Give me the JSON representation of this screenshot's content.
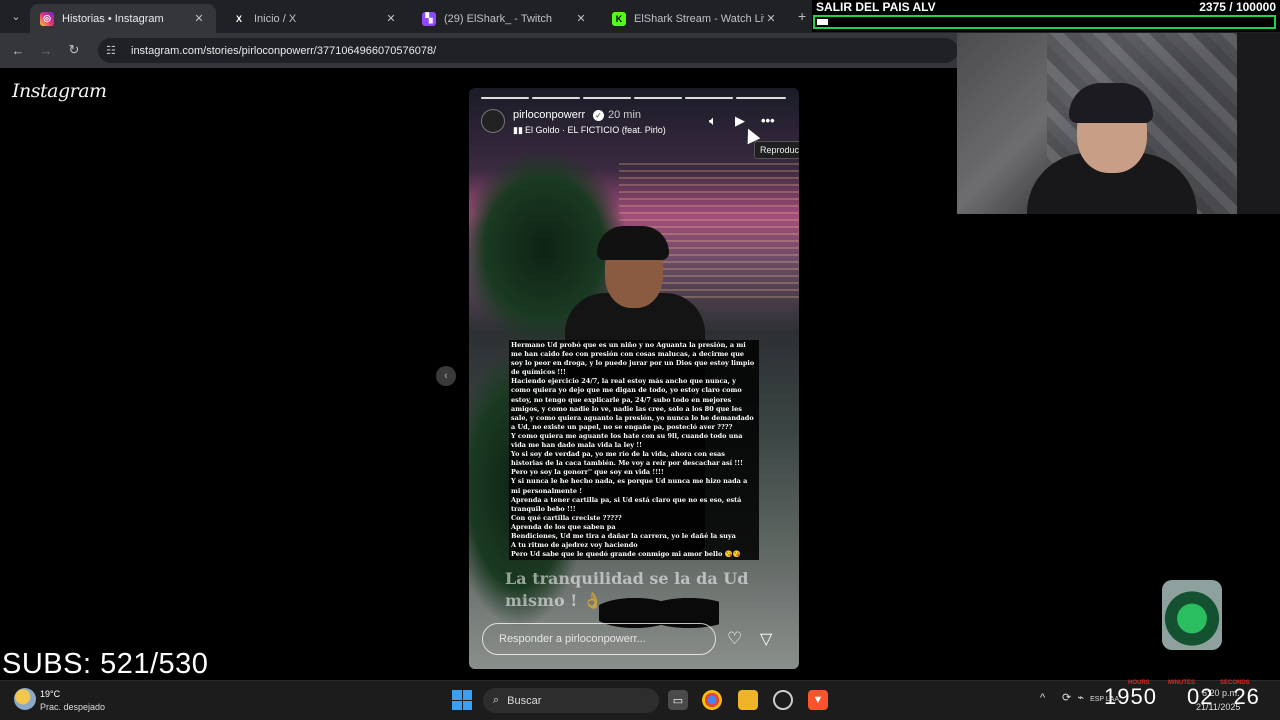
{
  "browser": {
    "tabs": [
      {
        "title": "Historias • Instagram",
        "active": true,
        "favicon": "instagram-icon"
      },
      {
        "title": "Inicio / X",
        "active": false,
        "favicon": "x-icon"
      },
      {
        "title": "(29) ElShark_ - Twitch",
        "active": false,
        "favicon": "twitch-icon"
      },
      {
        "title": "ElShark Stream - Watch Live on",
        "active": false,
        "favicon": "kick-icon"
      }
    ],
    "url": "instagram.com/stories/pirloconpowerr/3771064966070576078/"
  },
  "instagram": {
    "logo": "Instagram",
    "story": {
      "username": "pirloconpowerr",
      "time": "20 min",
      "music": "El Goldo · EL FICTICIO (feat. Pirlo)",
      "tooltip": "Reproducir",
      "text_lines": [
        "Hermano Ud probó que es un niño y no Aguanta la presión, a mi me han caido feo con presión con cosas malucas, a decirme que soy lo peor en droga, y lo puedo jurar por un Dios que estoy limpio de químicos !!!",
        "Haciendo ejercicio 24/7, la real estoy más ancho que nunca, y como quiera yo dejo que me digan de todo, yo estoy claro como estoy, no tengo que explicarle pa, 24/7 subo todo en mejores amigos, y como nadie lo ve, nadie las cree, solo a los 80 que les sale, y como quiera aguanto la presión, yo nunca lo he demandado a Ud, no existe un papel, no se engañe pa, postecló aver ????",
        "Y como quiera me aguante los hate con su 9ll, cuando todo una vida me han dado mala vida la ley !!",
        "Yo si soy de verdad pa, yo me río de la vida, ahora con esas historias de la caca también. Me voy a reír por descachar así !!!",
        "Pero yo soy la gonorr'' que soy en vida !!!!",
        "Y si nunca le he hecho nada, es porque Ud nunca me hizo nada a mi personalmente !",
        "Aprenda a tener cartilla pa, si Ud está claro que no es eso, está tranquilo bebo !!!",
        "Con qué cartilla creciste ?????",
        "Aprenda de los que saben pa",
        "Bendiciones, Ud me tira a dañar la carrera, yo le dañé la suya",
        "A tu ritmo de ajedrez voy haciendo",
        "Pero Ud sabe que le quedó grande conmigo mi amor bello 😘😘"
      ],
      "caption": "La tranquilidad se la da Ud mismo ! 👌",
      "reply_placeholder": "Responder a pirloconpowerr..."
    }
  },
  "stream_overlay": {
    "goal_title": "SALIR DEL PAIS ALV",
    "goal_count": "2375 / 100000",
    "goal_progress": 0.02375,
    "subs": "SUBS: 521/530",
    "timer": {
      "hours": "1950",
      "minutes": "02",
      "seconds": "26",
      "label_hours": "HOURS",
      "label_minutes": "MINUTES",
      "label_seconds": "SECONDS"
    }
  },
  "taskbar": {
    "weather_temp": "19°C",
    "weather_desc": "Prac. despejado",
    "search_label": "Buscar",
    "clock_time": "6:20 p.m.",
    "clock_date": "21/11/2025",
    "tray_lang": "ESP LAA"
  },
  "colors": {
    "goal_border": "#1fd44a",
    "instagram_bg": "#000000",
    "chrome_dark": "#202124"
  }
}
